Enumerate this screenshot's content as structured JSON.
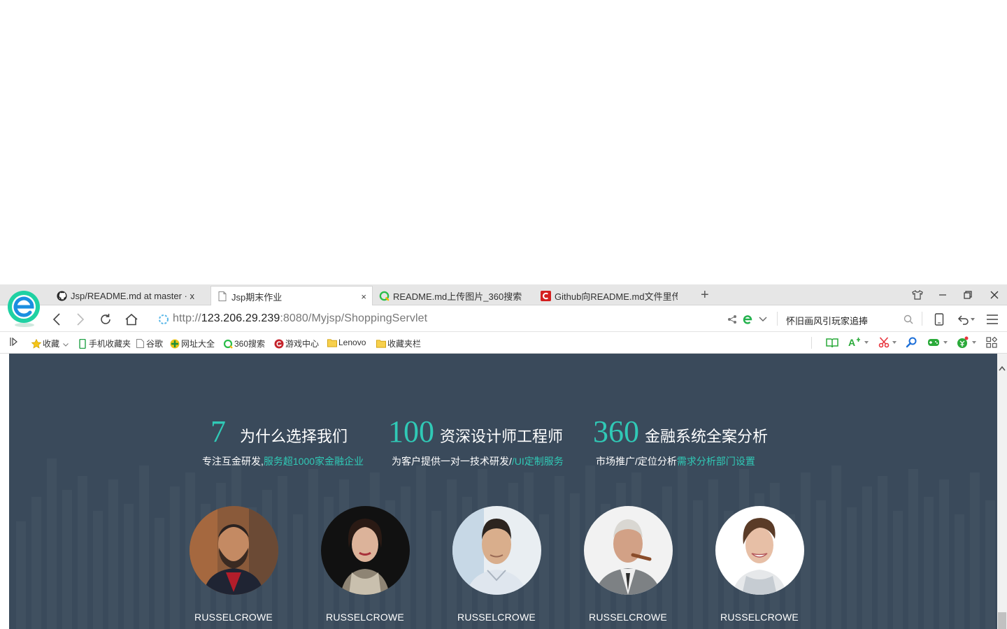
{
  "tabs": [
    {
      "title": "Jsp/README.md at master · x",
      "icon": "github-icon"
    },
    {
      "title": "Jsp期末作业",
      "icon": "page-icon",
      "close": "×"
    },
    {
      "title": "README.md上传图片_360搜索",
      "icon": "360-search-icon"
    },
    {
      "title": "Github向README.md文件里传",
      "icon": "csdn-icon"
    }
  ],
  "new_tab_label": "+",
  "address": {
    "scheme": "http://",
    "host": "123.206.29.239",
    "rest": ":8080/Myjsp/ShoppingServlet"
  },
  "search_box": {
    "value": "怀旧画风引玩家追捧"
  },
  "bookmarks": [
    {
      "label": "收藏",
      "icon": "star-icon"
    },
    {
      "label": "手机收藏夹",
      "icon": "phone-icon"
    },
    {
      "label": "谷歌",
      "icon": "page-icon"
    },
    {
      "label": "网址大全",
      "icon": "site-nav-icon"
    },
    {
      "label": "360搜索",
      "icon": "360-search-icon"
    },
    {
      "label": "游戏中心",
      "icon": "game-center-icon"
    },
    {
      "label": "Lenovo",
      "icon": "folder-icon"
    },
    {
      "label": "收藏夹栏",
      "icon": "folder-icon"
    }
  ],
  "stats": [
    {
      "number": "7",
      "heading": "为什么选择我们",
      "desc_plain": "专注互金研发,",
      "desc_highlight": "服务超1000家金融企业"
    },
    {
      "number": "100",
      "heading": "资深设计师工程师",
      "desc_plain": "为客户提供一对一技术研发/",
      "desc_highlight": "/UI定制服务"
    },
    {
      "number": "360",
      "heading": "金融系统全案分析",
      "desc_plain": "市场推广/定位分析",
      "desc_highlight": "需求分析部门设置"
    }
  ],
  "team": [
    {
      "name": "RUSSELCROWE"
    },
    {
      "name": "RUSSELCROWE"
    },
    {
      "name": "RUSSELCROWE"
    },
    {
      "name": "RUSSELCROWE"
    },
    {
      "name": "RUSSELCROWE"
    }
  ],
  "colors": {
    "accent": "#30c9b6",
    "page_bg": "#3a4a5b",
    "browser_logo": "#22c98a"
  }
}
